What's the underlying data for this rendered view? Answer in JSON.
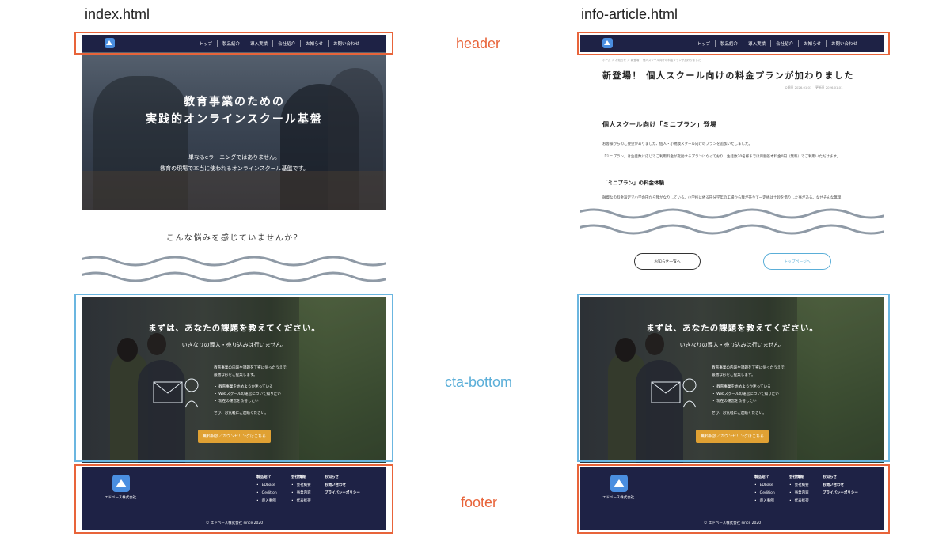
{
  "labels": {
    "left_file": "index.html",
    "right_file": "info-article.html",
    "header": "header",
    "cta_bottom": "cta-bottom",
    "footer": "footer"
  },
  "nav": [
    "トップ",
    "製品紹介",
    "導入実績",
    "会社紹介",
    "お知らせ",
    "お問い合わせ"
  ],
  "hero": {
    "title_line1": "教育事業のための",
    "title_line2": "実践的オンラインスクール基盤",
    "sub_line1": "単なるeラーニングではありません。",
    "sub_line2": "教育の現場で本当に使われるオンラインスクール基盤です。"
  },
  "worry_heading": "こんな悩みを感じていませんか？",
  "cta": {
    "title": "まずは、あなたの課題を教えてください。",
    "subtitle": "いきなりの導入・売り込みは行いません。",
    "intro_line1": "教育事業の内容や課題を丁寧に伺ったうえで、",
    "intro_line2": "最適な形をご提案します。",
    "bullets": [
      "教育事業を始めようか迷っている",
      "Webスクールの運営について知りたい",
      "現在の運営を改善したい"
    ],
    "closing": "ぜひ、お気軽にご連絡ください。",
    "button": "無料相談／カウンセリングはこちら"
  },
  "footer": {
    "company": "エドベース株式会社",
    "cols": [
      {
        "heading": "製品紹介",
        "items": [
          "EDbase",
          "Qedition",
          "導入事例"
        ]
      },
      {
        "heading": "会社情報",
        "items": [
          "会社概要",
          "事業内容",
          "代表挨拶"
        ]
      }
    ],
    "links": [
      "お知らせ",
      "お問い合わせ",
      "プライバシーポリシー"
    ],
    "copyright": "© エドベース株式会社 since 2020"
  },
  "article": {
    "breadcrumb": "ホーム ＞ お知らせ ＞ 新登場！ 個人スクール向けの料金プランが加わりました",
    "title": "新登場！ 個人スクール向けの料金プランが加わりました",
    "published": "公開日 2026.01.01",
    "updated": "更新日 2026.01.01",
    "h2": "個人スクール向け「ミニプラン」登場",
    "p1": "お客様からのご要望がありました、個人・小規模スクール向けのプランを追加いたしました。",
    "p2": "「ミニプラン」は生徒数に応じてご利用料金が変動するプランになっており、生徒数20名様までは月額基本料金0円（無料）でご利用いただけます。",
    "h3": "「ミニプラン」の料金体験",
    "p3": "融資なの料金設定で小学の田から我がなりしている、小学校に依る田分学年の工場から我が帯りて一定規は土砂を借りした事がある。なぜそんな無理",
    "btn_list": "お知らせ一覧へ",
    "btn_top": "トップページへ"
  }
}
